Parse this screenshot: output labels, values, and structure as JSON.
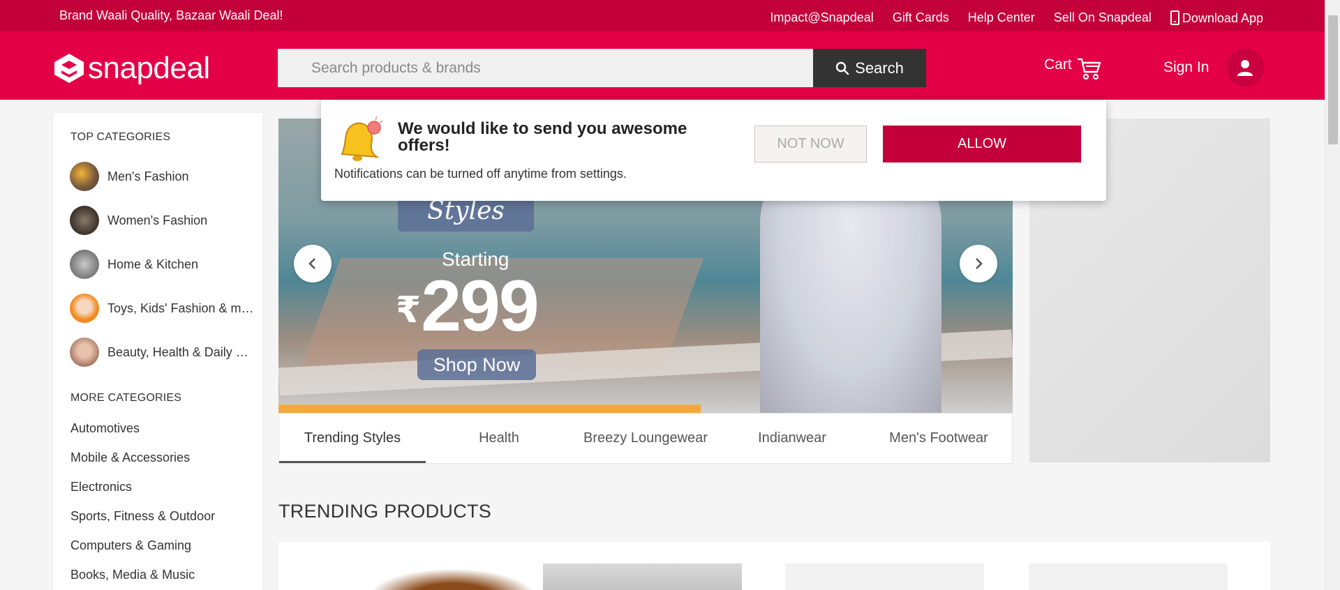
{
  "topbar": {
    "tagline": "Brand Waali Quality, Bazaar Waali Deal!",
    "links": [
      "Impact@Snapdeal",
      "Gift Cards",
      "Help Center",
      "Sell On Snapdeal"
    ],
    "download_app": "Download App"
  },
  "header": {
    "logo_text": "snapdeal",
    "search_placeholder": "Search products & brands",
    "search_button": "Search",
    "cart_label": "Cart",
    "signin_label": "Sign In"
  },
  "sidebar": {
    "top_heading": "TOP CATEGORIES",
    "top_categories": [
      {
        "label": "Men's Fashion"
      },
      {
        "label": "Women's Fashion"
      },
      {
        "label": "Home & Kitchen"
      },
      {
        "label": "Toys, Kids' Fashion & more"
      },
      {
        "label": "Beauty, Health & Daily Needs"
      }
    ],
    "more_heading": "MORE CATEGORIES",
    "more_categories": [
      "Automotives",
      "Mobile & Accessories",
      "Electronics",
      "Sports, Fitness & Outdoor",
      "Computers & Gaming",
      "Books, Media & Music"
    ]
  },
  "banner": {
    "tag": "Styles",
    "starting": "Starting",
    "currency": "₹",
    "price": "299",
    "cta": "Shop Now"
  },
  "tabs": [
    {
      "label": "Trending Styles",
      "active": true
    },
    {
      "label": "Health",
      "active": false
    },
    {
      "label": "Breezy Loungewear",
      "active": false
    },
    {
      "label": "Indianwear",
      "active": false
    },
    {
      "label": "Men's Footwear",
      "active": false
    }
  ],
  "section": {
    "trending_title": "TRENDING PRODUCTS"
  },
  "notification": {
    "title": "We would like to send you awesome offers!",
    "subtitle": "Notifications can be turned off anytime from settings.",
    "not_now": "NOT NOW",
    "allow": "ALLOW"
  },
  "colors": {
    "brand": "#e40046",
    "brand_dark": "#c4003b",
    "search_button": "#333333"
  }
}
